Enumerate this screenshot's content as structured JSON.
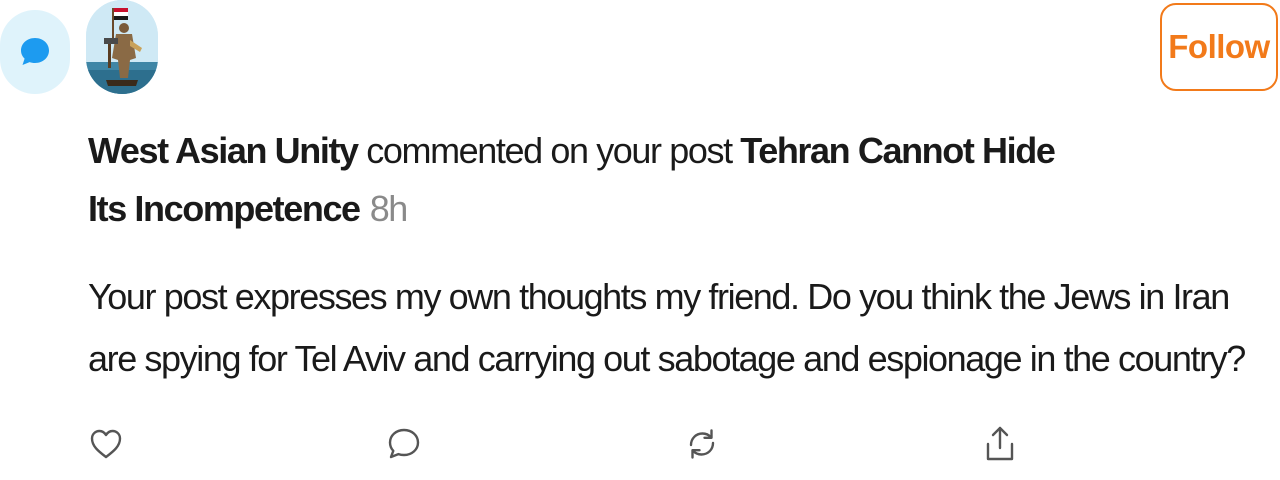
{
  "notification": {
    "type_icon": "comment-bubble-icon",
    "avatar": "profile-avatar-statue-with-flag",
    "actor": "West Asian Unity",
    "action_text": " commented on your post ",
    "post_title": "Tehran Cannot Hide Its Incompetence",
    "time": "8h",
    "comment": "Your post expresses my own thoughts my friend. Do you think the Jews in Iran are spying for Tel Aviv and carrying out sabotage and espionage in the country?"
  },
  "follow_button": {
    "label": "Follow",
    "color": "#f27a1a"
  },
  "actions": {
    "like_icon": "heart-icon",
    "reply_icon": "comment-icon",
    "restack_icon": "restack-icon",
    "share_icon": "share-icon"
  },
  "colors": {
    "badge_bg": "#dff3fb",
    "badge_icon": "#1d9bf0",
    "time_text": "#8a8a8a"
  }
}
